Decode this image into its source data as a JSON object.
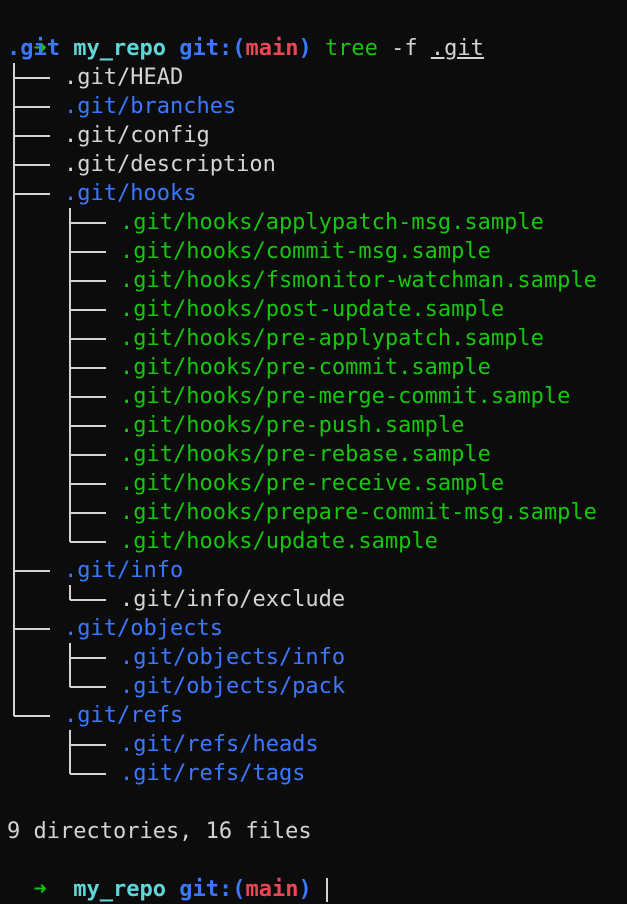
{
  "prompt": {
    "arrow": "➜",
    "repo": "my_repo",
    "git_open": "git:(",
    "branch": "main",
    "git_close": ")",
    "command": "tree",
    "flag": "-f",
    "target": ".git"
  },
  "tree": {
    "root": ".git",
    "entries": [
      {
        "path": ".git/HEAD",
        "kind": "file"
      },
      {
        "path": ".git/branches",
        "kind": "dir"
      },
      {
        "path": ".git/config",
        "kind": "file"
      },
      {
        "path": ".git/description",
        "kind": "file"
      },
      {
        "path": ".git/hooks",
        "kind": "dir"
      },
      {
        "path": ".git/hooks/applypatch-msg.sample",
        "kind": "exec"
      },
      {
        "path": ".git/hooks/commit-msg.sample",
        "kind": "exec"
      },
      {
        "path": ".git/hooks/fsmonitor-watchman.sample",
        "kind": "exec"
      },
      {
        "path": ".git/hooks/post-update.sample",
        "kind": "exec"
      },
      {
        "path": ".git/hooks/pre-applypatch.sample",
        "kind": "exec"
      },
      {
        "path": ".git/hooks/pre-commit.sample",
        "kind": "exec"
      },
      {
        "path": ".git/hooks/pre-merge-commit.sample",
        "kind": "exec"
      },
      {
        "path": ".git/hooks/pre-push.sample",
        "kind": "exec"
      },
      {
        "path": ".git/hooks/pre-rebase.sample",
        "kind": "exec"
      },
      {
        "path": ".git/hooks/pre-receive.sample",
        "kind": "exec"
      },
      {
        "path": ".git/hooks/prepare-commit-msg.sample",
        "kind": "exec"
      },
      {
        "path": ".git/hooks/update.sample",
        "kind": "exec"
      },
      {
        "path": ".git/info",
        "kind": "dir"
      },
      {
        "path": ".git/info/exclude",
        "kind": "file"
      },
      {
        "path": ".git/objects",
        "kind": "dir"
      },
      {
        "path": ".git/objects/info",
        "kind": "dir"
      },
      {
        "path": ".git/objects/pack",
        "kind": "dir"
      },
      {
        "path": ".git/refs",
        "kind": "dir"
      },
      {
        "path": ".git/refs/heads",
        "kind": "dir"
      },
      {
        "path": ".git/refs/tags",
        "kind": "dir"
      }
    ]
  },
  "summary": "9 directories, 16 files",
  "colors": {
    "background": "#0c0c0c",
    "directory": "#3b78ff",
    "executable": "#16c60c",
    "file": "#d4d4d4",
    "branch": "#e74856",
    "repo": "#61d6d6"
  }
}
